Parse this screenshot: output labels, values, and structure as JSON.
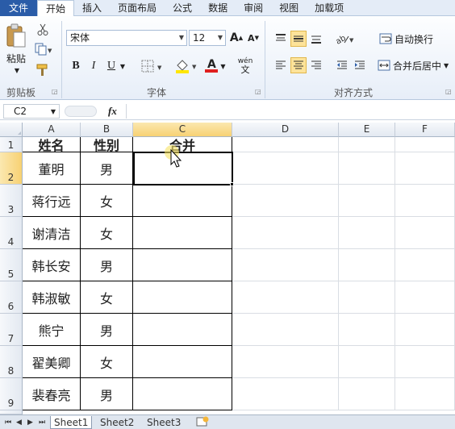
{
  "ribbon_tabs": [
    "文件",
    "开始",
    "插入",
    "页面布局",
    "公式",
    "数据",
    "审阅",
    "视图",
    "加载项"
  ],
  "clipboard": {
    "paste_label": "粘贴",
    "group_label": "剪贴板"
  },
  "font": {
    "name": "宋体",
    "size": "12",
    "group_label": "字体",
    "bold": "B",
    "italic": "I",
    "underline": "U",
    "font_color_letter": "A",
    "phonetic": "wén"
  },
  "align": {
    "wrap_label": "自动换行",
    "merge_label": "合并后居中",
    "group_label": "对齐方式"
  },
  "formula_bar": {
    "name_box": "C2",
    "fx": "fx",
    "value": ""
  },
  "columns": [
    "A",
    "B",
    "C",
    "D",
    "E",
    "F"
  ],
  "rows": [
    {
      "num": "1",
      "name": "姓名",
      "gender": "性别",
      "merge": "合并"
    },
    {
      "num": "2",
      "name": "董明",
      "gender": "男",
      "merge": ""
    },
    {
      "num": "3",
      "name": "蒋行远",
      "gender": "女",
      "merge": ""
    },
    {
      "num": "4",
      "name": "谢清洁",
      "gender": "女",
      "merge": ""
    },
    {
      "num": "5",
      "name": "韩长安",
      "gender": "男",
      "merge": ""
    },
    {
      "num": "6",
      "name": "韩淑敏",
      "gender": "女",
      "merge": ""
    },
    {
      "num": "7",
      "name": "熊宁",
      "gender": "男",
      "merge": ""
    },
    {
      "num": "8",
      "name": "翟美卿",
      "gender": "女",
      "merge": ""
    },
    {
      "num": "9",
      "name": "裴春亮",
      "gender": "男",
      "merge": ""
    }
  ],
  "sheets": [
    "Sheet1",
    "Sheet2",
    "Sheet3"
  ],
  "colors": {
    "file_tab": "#2a5ca8",
    "selection_header": "#f7d173",
    "selected_button": "#fde39a"
  }
}
